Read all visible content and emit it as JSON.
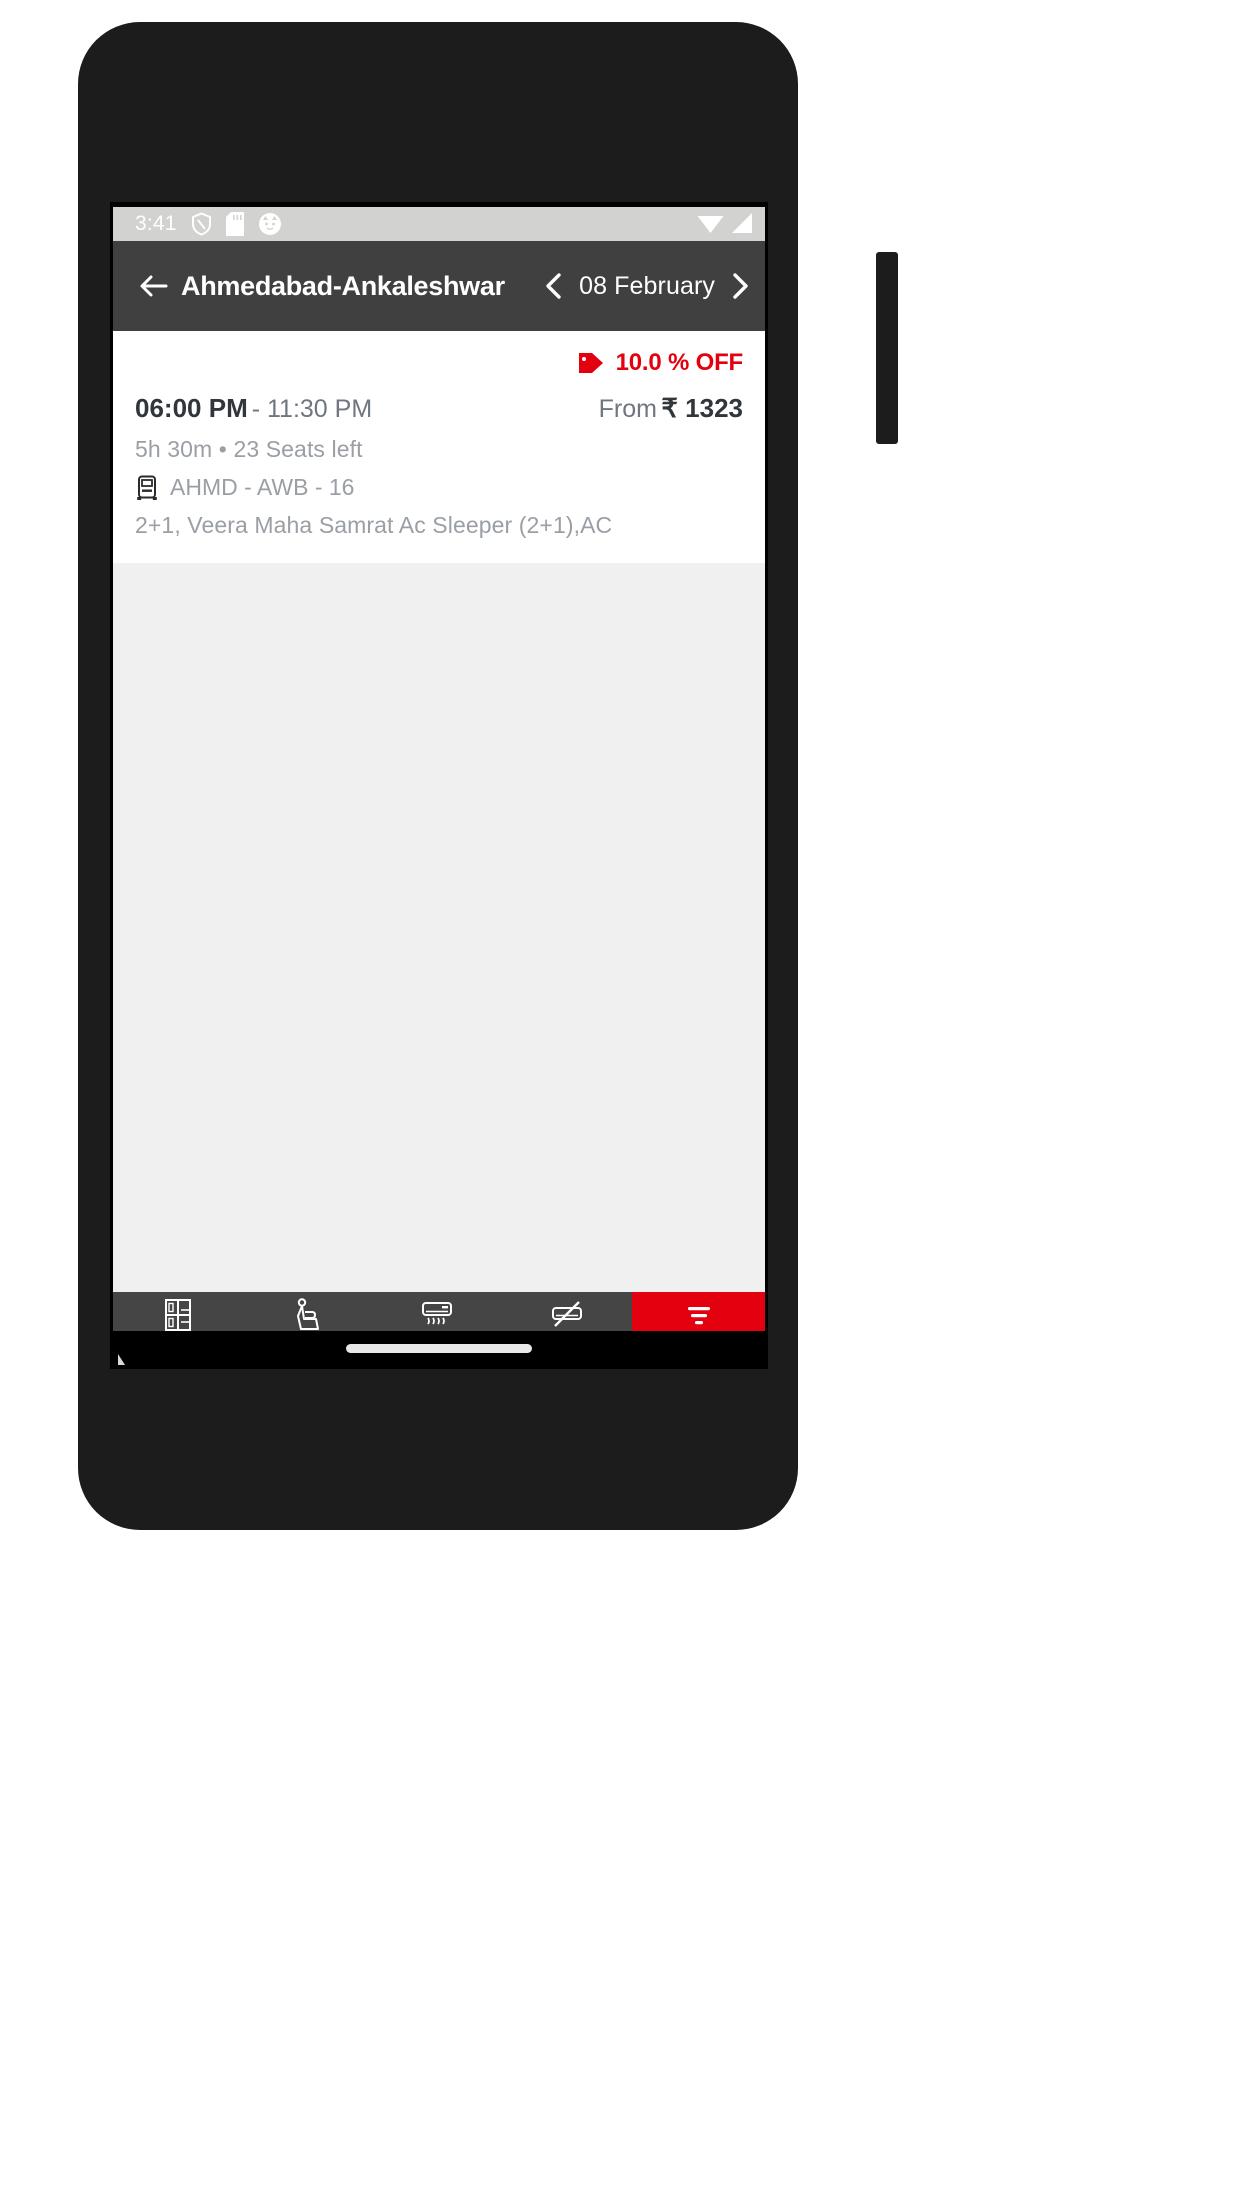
{
  "status_bar": {
    "time": "3:41",
    "icons_left": [
      "shield-icon",
      "sd-card-icon",
      "cat-face-icon"
    ],
    "icons_right": [
      "wifi-icon",
      "signal-icon"
    ],
    "background_color": "#d2d2d0"
  },
  "app_bar": {
    "back_icon": "back-arrow-icon",
    "route_title": "Ahmedabad-Ankaleshwar",
    "prev_icon": "chevron-left-icon",
    "date": "08 February",
    "next_icon": "chevron-right-icon",
    "background_color": "#404040"
  },
  "bus_card": {
    "offer_icon": "offer-tag-icon",
    "offer_label": "10.0 % OFF",
    "offer_color": "#e3000f",
    "departure_time": "06:00 PM",
    "arrival_separator": "- 11:30 PM",
    "price_prefix": "From",
    "price_value": "₹ 1323",
    "duration_seats": "5h 30m • 23 Seats left",
    "bus_icon": "bus-icon",
    "bus_code": "AHMD - AWB - 16",
    "bus_description": "2+1, Veera Maha Samrat Ac Sleeper (2+1),AC"
  },
  "bottom_bar": {
    "items": [
      {
        "label": "Sleeper",
        "icon": "sleeper-berth-icon",
        "accent": false
      },
      {
        "label": "Seater",
        "icon": "seat-icon",
        "accent": false
      },
      {
        "label": "AC",
        "icon": "ac-unit-icon",
        "accent": false
      },
      {
        "label": "Non-AC",
        "icon": "ac-unit-off-icon",
        "accent": false
      },
      {
        "label": "Sort & Filter",
        "icon": "filter-icon",
        "accent": true
      }
    ],
    "background_color": "#454545",
    "accent_color": "#e3000f"
  }
}
